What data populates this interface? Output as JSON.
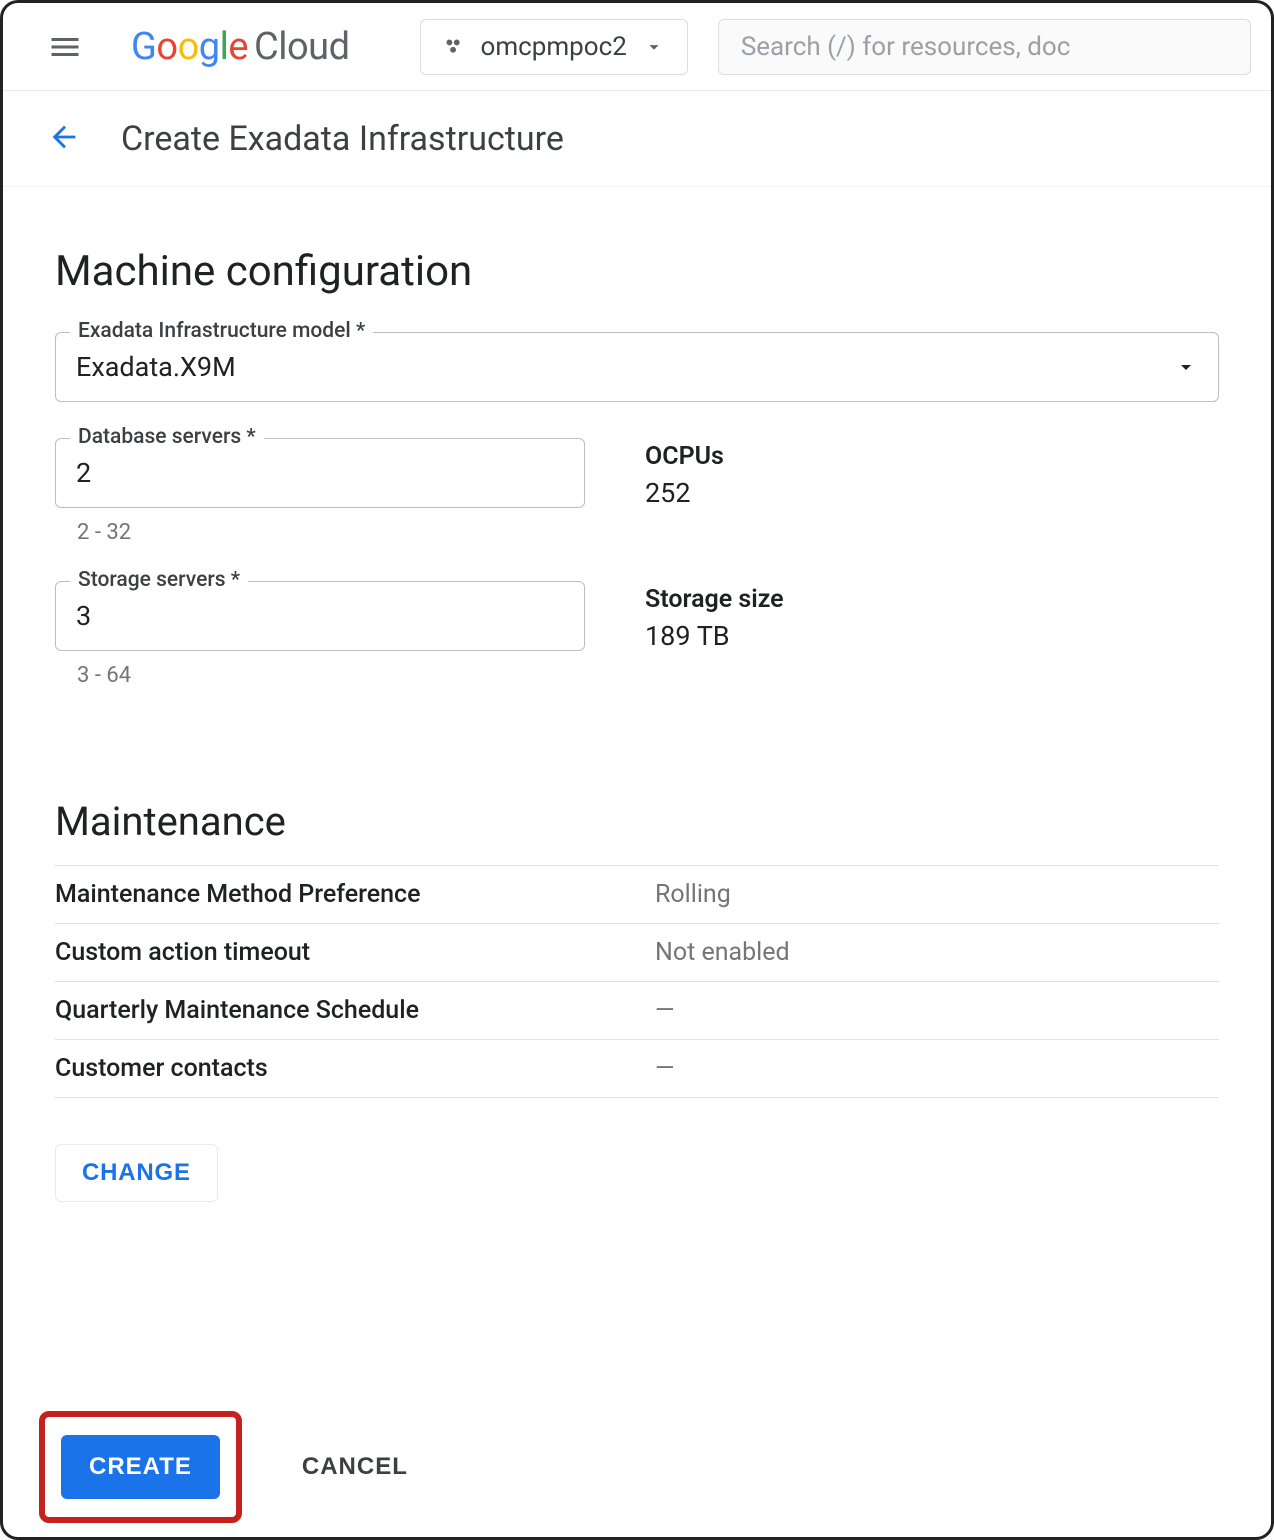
{
  "topbar": {
    "project_name": "omcpmpoc2",
    "search_placeholder": "Search (/) for resources, doc"
  },
  "logo": {
    "g": "G",
    "o1": "o",
    "o2": "o",
    "g2": "g",
    "l": "l",
    "e": "e",
    "cloud": "Cloud"
  },
  "subheader": {
    "page_title": "Create Exadata Infrastructure"
  },
  "machine_config": {
    "section_title": "Machine configuration",
    "model_label": "Exadata Infrastructure model *",
    "model_value": "Exadata.X9M",
    "db_servers_label": "Database servers *",
    "db_servers_value": "2",
    "db_servers_helper": "2 - 32",
    "ocpus_label": "OCPUs",
    "ocpus_value": "252",
    "storage_servers_label": "Storage servers *",
    "storage_servers_value": "3",
    "storage_servers_helper": "3 - 64",
    "storage_size_label": "Storage size",
    "storage_size_value": "189 TB"
  },
  "maintenance": {
    "section_title": "Maintenance",
    "rows": [
      {
        "label": "Maintenance Method Preference",
        "value": "Rolling"
      },
      {
        "label": "Custom action timeout",
        "value": "Not enabled"
      },
      {
        "label": "Quarterly Maintenance Schedule",
        "value": "—"
      },
      {
        "label": "Customer contacts",
        "value": "—"
      }
    ],
    "change_label": "CHANGE"
  },
  "footer": {
    "create_label": "CREATE",
    "cancel_label": "CANCEL"
  }
}
